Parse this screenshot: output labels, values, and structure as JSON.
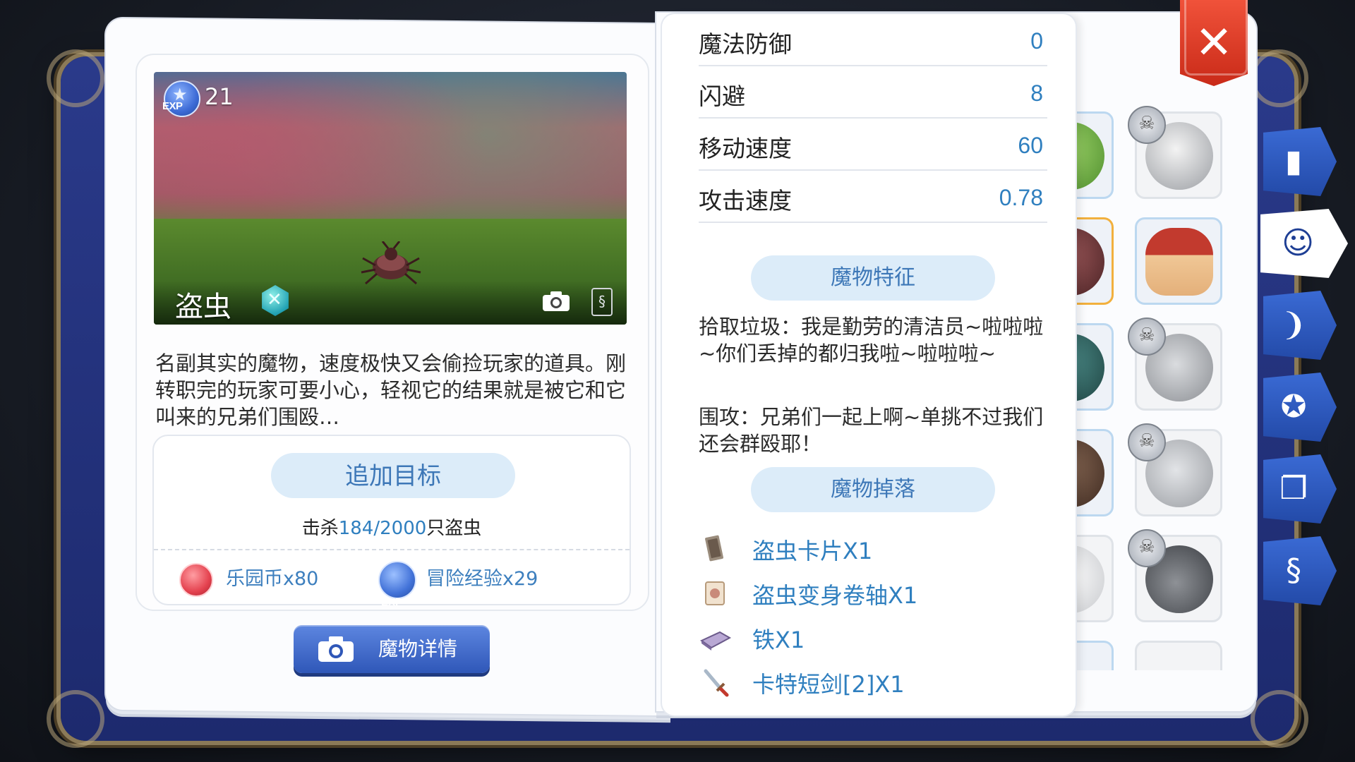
{
  "monster": {
    "name": "盗虫",
    "exp_label": "EXP",
    "level": "21",
    "description": "名副其实的魔物，速度极快又会偷捡玩家的道具。刚转职完的玩家可要小心，轻视它的结果就是被它和它叫来的兄弟们围殴…"
  },
  "target": {
    "add_button": "追加目标",
    "kill_prefix": "击杀",
    "kill_count": "184/2000",
    "kill_suffix": "只盗虫",
    "rewards": [
      {
        "icon": "coin-icon",
        "label": "乐园币x80"
      },
      {
        "icon": "exp-icon",
        "label": "冒险经验x29"
      }
    ]
  },
  "detail_button": "魔物详情",
  "stats": [
    {
      "label": "魔法防御",
      "value": "0"
    },
    {
      "label": "闪避",
      "value": "8"
    },
    {
      "label": "移动速度",
      "value": "60"
    },
    {
      "label": "攻击速度",
      "value": "0.78"
    }
  ],
  "traits": {
    "title": "魔物特征",
    "items": [
      "拾取垃圾：我是勤劳的清洁员~啦啦啦~你们丢掉的都归我啦~啦啦啦~",
      "围攻：兄弟们一起上啊~单挑不过我们还会群殴耶！"
    ]
  },
  "drops": {
    "title": "魔物掉落",
    "items": [
      {
        "icon": "card-icon",
        "label": "盗虫卡片X1"
      },
      {
        "icon": "scroll-icon",
        "label": "盗虫变身卷轴X1"
      },
      {
        "icon": "iron-icon",
        "label": "铁X1"
      },
      {
        "icon": "dagger-icon",
        "label": "卡特短剑[2]X1"
      }
    ]
  },
  "side_tabs": [
    "book-icon",
    "monster-face-icon",
    "horn-icon",
    "head-idea-icon",
    "open-book-icon",
    "card-icon"
  ],
  "colors": {
    "accent_blue": "#2f7fbf",
    "pill_bg": "#dcecf9",
    "close_red": "#e0412a",
    "tab_blue": "#2f5cc2"
  }
}
